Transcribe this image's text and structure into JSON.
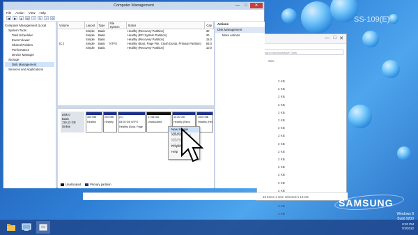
{
  "desktop": {
    "model": "SS-109(E)",
    "brand": "SAMSUNG",
    "windows_version": [
      "Windows 8",
      "Build 9200"
    ]
  },
  "explorer": {
    "search_placeholder": "Search Administrative Tools",
    "size_header": "Size",
    "sizes": [
      "2 KB",
      "2 KB",
      "2 KB",
      "2 KB",
      "2 KB",
      "2 KB",
      "2 KB",
      "2 KB",
      "2 KB",
      "2 KB",
      "2 KB",
      "2 KB",
      "2 KB",
      "2 KB",
      "2 KB",
      "2 KB",
      "2 KB",
      "2 KB"
    ],
    "status": "15 items    1 item selected  1.13 KB"
  },
  "window": {
    "title": "Computer Management",
    "menu": [
      "File",
      "Action",
      "View",
      "Help"
    ],
    "toolbar_icons": [
      "back-icon",
      "forward-icon",
      "up-icon",
      "properties-icon",
      "help-icon",
      "refresh-icon",
      "export-icon",
      "settings-icon"
    ]
  },
  "tree": [
    {
      "label": "Computer Management (Local",
      "level": 0
    },
    {
      "label": "System Tools",
      "level": 1
    },
    {
      "label": "Task Scheduler",
      "level": 2
    },
    {
      "label": "Event Viewer",
      "level": 2
    },
    {
      "label": "Shared Folders",
      "level": 2
    },
    {
      "label": "Performance",
      "level": 2
    },
    {
      "label": "Device Manager",
      "level": 2
    },
    {
      "label": "Storage",
      "level": 1
    },
    {
      "label": "Disk Management",
      "level": 2,
      "selected": true
    },
    {
      "label": "Services and Applications",
      "level": 1
    }
  ],
  "volumes": {
    "columns": [
      "Volume",
      "Layout",
      "Type",
      "File System",
      "Status",
      "Cap"
    ],
    "rows": [
      [
        "",
        "Simple",
        "Basic",
        "",
        "Healthy (Recovery Partition)",
        "30"
      ],
      [
        "",
        "Simple",
        "Basic",
        "",
        "Healthy (EFI System Partition)",
        "20"
      ],
      [
        "",
        "Simple",
        "Basic",
        "",
        "Healthy (Recovery Partition)",
        "15.0"
      ],
      [
        "(C:)",
        "Simple",
        "Basic",
        "NTFS",
        "Healthy (Boot, Page File, Crash Dump, Primary Partition)",
        "83.0"
      ],
      [
        "",
        "Simple",
        "Basic",
        "",
        "Healthy (Recovery Partition)",
        "10.0"
      ]
    ]
  },
  "disk": {
    "label": [
      "Disk 0",
      "Basic",
      "119.12 GB",
      "Online"
    ],
    "partitions": [
      {
        "size": "300 MB",
        "status": "Healthy",
        "unallocated": false
      },
      {
        "size": "200 MB",
        "status": "Healthy",
        "unallocated": false
      },
      {
        "size": "(C:)",
        "line2": "83.00 GB NTFS",
        "status": "Healthy (Boot, Page",
        "unallocated": false
      },
      {
        "size": "17.58 GB",
        "status": "Unallocated",
        "unallocated": true
      },
      {
        "size": "10.00 GB",
        "status": "Healthy (Reco",
        "unallocated": false
      },
      {
        "size": "1000 MB",
        "status": "Healthy (Reco",
        "unallocated": false
      }
    ],
    "legend": [
      "Unallocated",
      "Primary partition"
    ]
  },
  "actions": {
    "header": "Actions",
    "section": "Disk Management",
    "item": "More Actions"
  },
  "context_menu": [
    "New Simple Volume...",
    "New Spanned Volume...",
    "New Striped Volume...",
    "Properties",
    "Help"
  ],
  "tray": {
    "time": "8:20 PM",
    "date": "7/3/2012"
  },
  "colors": {
    "primary_partition": "#1c2f8e",
    "unallocated": "#111111"
  }
}
